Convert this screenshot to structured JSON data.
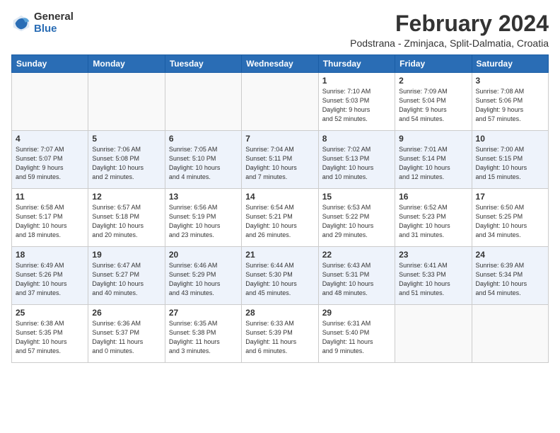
{
  "logo": {
    "general": "General",
    "blue": "Blue"
  },
  "title": "February 2024",
  "subtitle": "Podstrana - Zminjaca, Split-Dalmatia, Croatia",
  "days_of_week": [
    "Sunday",
    "Monday",
    "Tuesday",
    "Wednesday",
    "Thursday",
    "Friday",
    "Saturday"
  ],
  "weeks": [
    [
      {
        "day": "",
        "info": ""
      },
      {
        "day": "",
        "info": ""
      },
      {
        "day": "",
        "info": ""
      },
      {
        "day": "",
        "info": ""
      },
      {
        "day": "1",
        "info": "Sunrise: 7:10 AM\nSunset: 5:03 PM\nDaylight: 9 hours\nand 52 minutes."
      },
      {
        "day": "2",
        "info": "Sunrise: 7:09 AM\nSunset: 5:04 PM\nDaylight: 9 hours\nand 54 minutes."
      },
      {
        "day": "3",
        "info": "Sunrise: 7:08 AM\nSunset: 5:06 PM\nDaylight: 9 hours\nand 57 minutes."
      }
    ],
    [
      {
        "day": "4",
        "info": "Sunrise: 7:07 AM\nSunset: 5:07 PM\nDaylight: 9 hours\nand 59 minutes."
      },
      {
        "day": "5",
        "info": "Sunrise: 7:06 AM\nSunset: 5:08 PM\nDaylight: 10 hours\nand 2 minutes."
      },
      {
        "day": "6",
        "info": "Sunrise: 7:05 AM\nSunset: 5:10 PM\nDaylight: 10 hours\nand 4 minutes."
      },
      {
        "day": "7",
        "info": "Sunrise: 7:04 AM\nSunset: 5:11 PM\nDaylight: 10 hours\nand 7 minutes."
      },
      {
        "day": "8",
        "info": "Sunrise: 7:02 AM\nSunset: 5:13 PM\nDaylight: 10 hours\nand 10 minutes."
      },
      {
        "day": "9",
        "info": "Sunrise: 7:01 AM\nSunset: 5:14 PM\nDaylight: 10 hours\nand 12 minutes."
      },
      {
        "day": "10",
        "info": "Sunrise: 7:00 AM\nSunset: 5:15 PM\nDaylight: 10 hours\nand 15 minutes."
      }
    ],
    [
      {
        "day": "11",
        "info": "Sunrise: 6:58 AM\nSunset: 5:17 PM\nDaylight: 10 hours\nand 18 minutes."
      },
      {
        "day": "12",
        "info": "Sunrise: 6:57 AM\nSunset: 5:18 PM\nDaylight: 10 hours\nand 20 minutes."
      },
      {
        "day": "13",
        "info": "Sunrise: 6:56 AM\nSunset: 5:19 PM\nDaylight: 10 hours\nand 23 minutes."
      },
      {
        "day": "14",
        "info": "Sunrise: 6:54 AM\nSunset: 5:21 PM\nDaylight: 10 hours\nand 26 minutes."
      },
      {
        "day": "15",
        "info": "Sunrise: 6:53 AM\nSunset: 5:22 PM\nDaylight: 10 hours\nand 29 minutes."
      },
      {
        "day": "16",
        "info": "Sunrise: 6:52 AM\nSunset: 5:23 PM\nDaylight: 10 hours\nand 31 minutes."
      },
      {
        "day": "17",
        "info": "Sunrise: 6:50 AM\nSunset: 5:25 PM\nDaylight: 10 hours\nand 34 minutes."
      }
    ],
    [
      {
        "day": "18",
        "info": "Sunrise: 6:49 AM\nSunset: 5:26 PM\nDaylight: 10 hours\nand 37 minutes."
      },
      {
        "day": "19",
        "info": "Sunrise: 6:47 AM\nSunset: 5:27 PM\nDaylight: 10 hours\nand 40 minutes."
      },
      {
        "day": "20",
        "info": "Sunrise: 6:46 AM\nSunset: 5:29 PM\nDaylight: 10 hours\nand 43 minutes."
      },
      {
        "day": "21",
        "info": "Sunrise: 6:44 AM\nSunset: 5:30 PM\nDaylight: 10 hours\nand 45 minutes."
      },
      {
        "day": "22",
        "info": "Sunrise: 6:43 AM\nSunset: 5:31 PM\nDaylight: 10 hours\nand 48 minutes."
      },
      {
        "day": "23",
        "info": "Sunrise: 6:41 AM\nSunset: 5:33 PM\nDaylight: 10 hours\nand 51 minutes."
      },
      {
        "day": "24",
        "info": "Sunrise: 6:39 AM\nSunset: 5:34 PM\nDaylight: 10 hours\nand 54 minutes."
      }
    ],
    [
      {
        "day": "25",
        "info": "Sunrise: 6:38 AM\nSunset: 5:35 PM\nDaylight: 10 hours\nand 57 minutes."
      },
      {
        "day": "26",
        "info": "Sunrise: 6:36 AM\nSunset: 5:37 PM\nDaylight: 11 hours\nand 0 minutes."
      },
      {
        "day": "27",
        "info": "Sunrise: 6:35 AM\nSunset: 5:38 PM\nDaylight: 11 hours\nand 3 minutes."
      },
      {
        "day": "28",
        "info": "Sunrise: 6:33 AM\nSunset: 5:39 PM\nDaylight: 11 hours\nand 6 minutes."
      },
      {
        "day": "29",
        "info": "Sunrise: 6:31 AM\nSunset: 5:40 PM\nDaylight: 11 hours\nand 9 minutes."
      },
      {
        "day": "",
        "info": ""
      },
      {
        "day": "",
        "info": ""
      }
    ]
  ]
}
